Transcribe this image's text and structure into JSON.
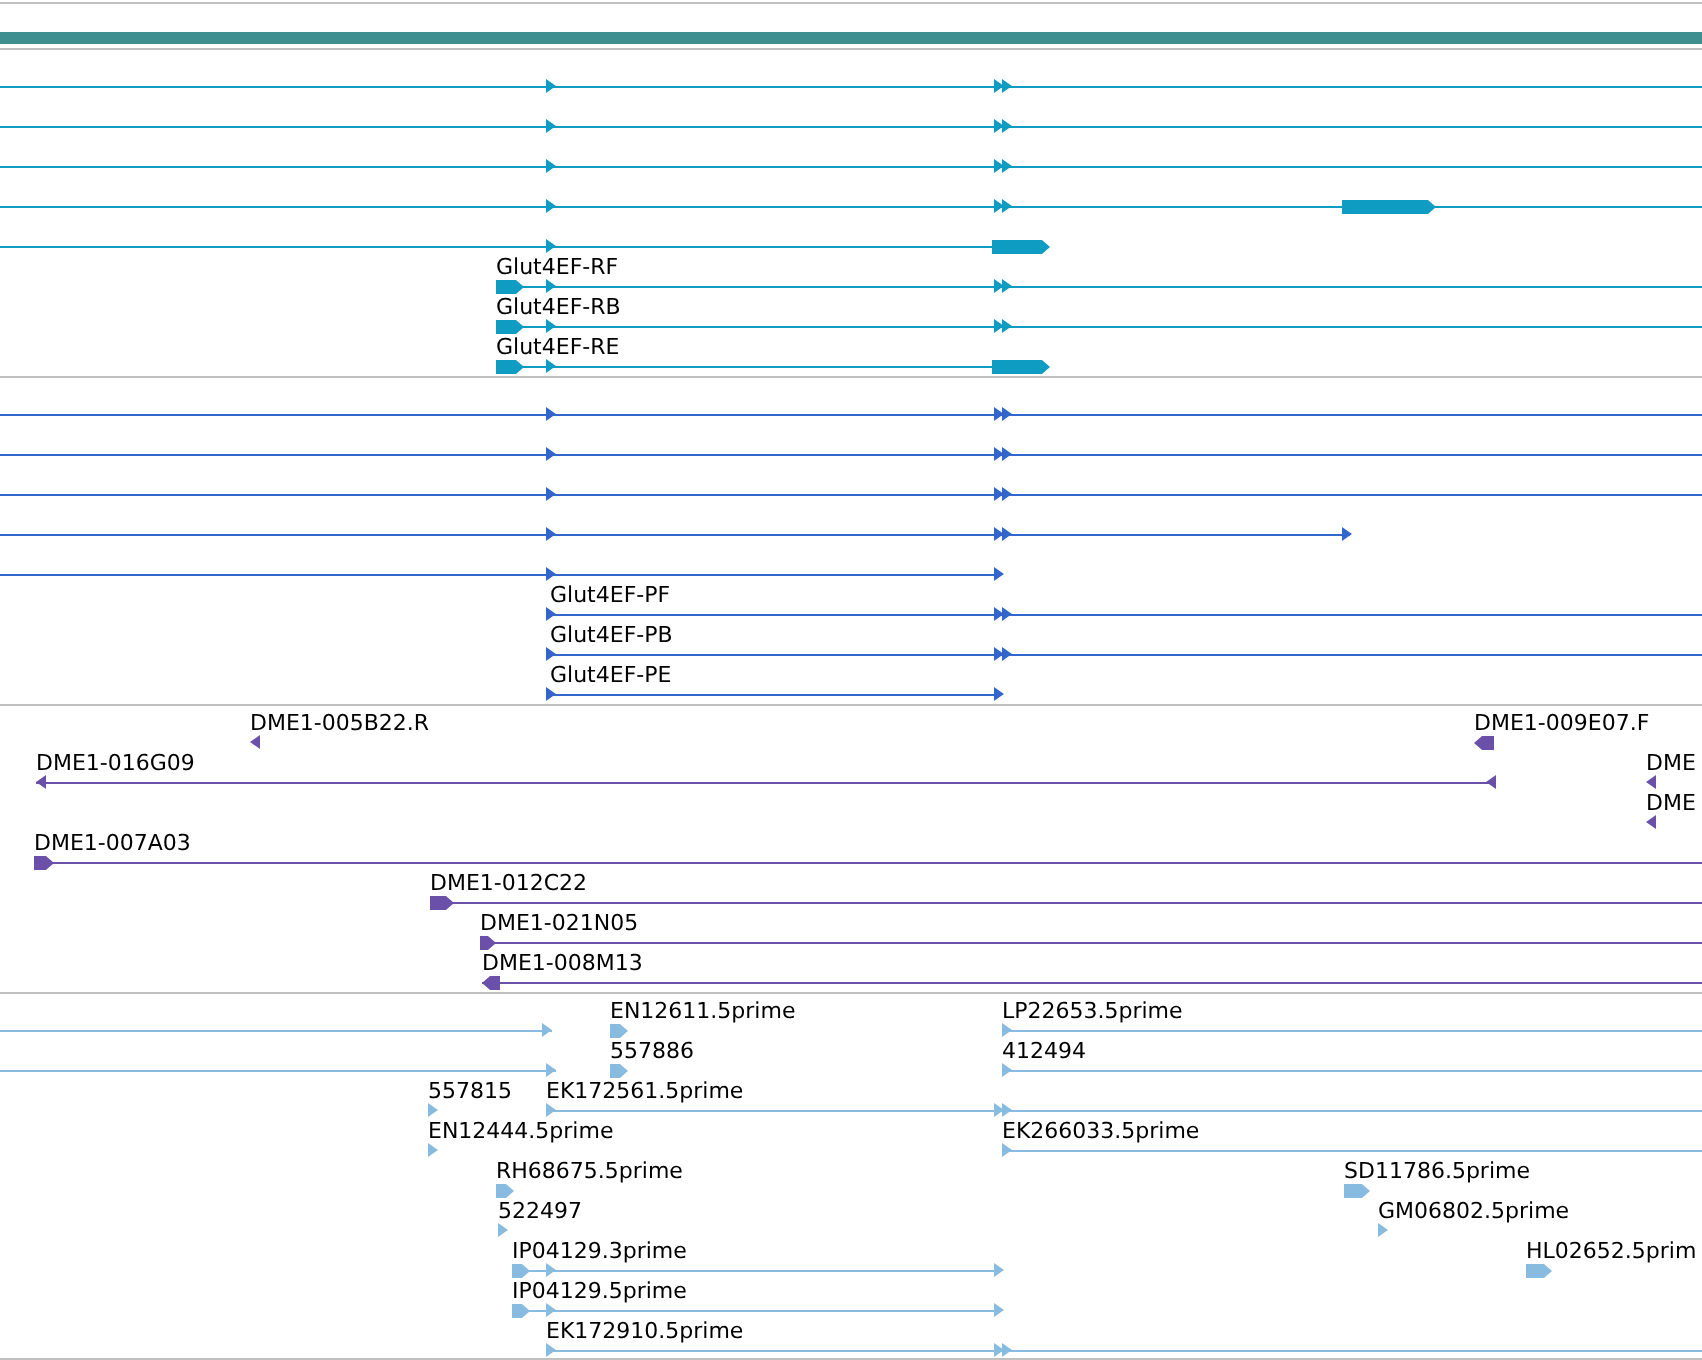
{
  "tracks": [
    {
      "color": "#0e9cc2",
      "features": [
        {
          "reverse": false
        },
        {
          "reverse": false
        },
        {
          "reverse": false
        },
        {
          "reverse": false
        },
        {
          "reverse": false
        },
        {
          "label": "Glut4EF-RF",
          "reverse": false
        },
        {
          "label": "Glut4EF-RB",
          "reverse": false
        },
        {
          "label": "Glut4EF-RE",
          "reverse": false
        }
      ]
    },
    {
      "color": "#3366cc",
      "features": [
        {
          "reverse": false
        },
        {
          "reverse": false
        },
        {
          "reverse": false
        },
        {
          "reverse": false
        },
        {
          "reverse": false
        },
        {
          "label": "Glut4EF-PF",
          "reverse": false
        },
        {
          "label": "Glut4EF-PB",
          "reverse": false
        },
        {
          "label": "Glut4EF-PE",
          "reverse": false
        }
      ]
    },
    {
      "color": "#6a50a8",
      "features": [
        {
          "label": "DME1-005B22.R",
          "reverse": true
        },
        {
          "label": "DME1-016G09",
          "reverse": true
        },
        {
          "label": "DME1-009E07.F",
          "reverse": true
        },
        {
          "label": "DME",
          "reverse": true
        },
        {
          "label": "DME",
          "reverse": true
        },
        {
          "label": "DME1-007A03",
          "reverse": false
        },
        {
          "label": "DME1-012C22",
          "reverse": false
        },
        {
          "label": "DME1-021N05",
          "reverse": false
        },
        {
          "label": "DME1-008M13",
          "reverse": true
        }
      ]
    },
    {
      "color": "#88bbe0",
      "features": [
        {
          "reverse": false
        },
        {
          "label": "EN12611.5prime",
          "reverse": false
        },
        {
          "label": "LP22653.5prime",
          "reverse": false
        },
        {
          "reverse": false
        },
        {
          "label": "557886",
          "reverse": false
        },
        {
          "label": "412494",
          "reverse": false
        },
        {
          "label": "557815",
          "reverse": false
        },
        {
          "label": "EK172561.5prime",
          "reverse": false
        },
        {
          "label": "EN12444.5prime",
          "reverse": false
        },
        {
          "label": "EK266033.5prime",
          "reverse": false
        },
        {
          "label": "RH68675.5prime",
          "reverse": false
        },
        {
          "label": "SD11786.5prime",
          "reverse": false
        },
        {
          "label": "522497",
          "reverse": false
        },
        {
          "label": "GM06802.5prime",
          "reverse": false
        },
        {
          "label": "IP04129.3prime",
          "reverse": false
        },
        {
          "label": "HL02652.5prim",
          "reverse": false
        },
        {
          "label": "IP04129.5prime",
          "reverse": false
        },
        {
          "label": "EK172910.5prime",
          "reverse": false
        }
      ]
    }
  ]
}
